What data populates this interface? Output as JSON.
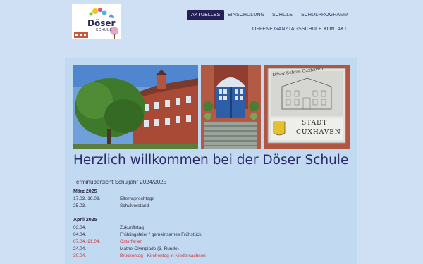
{
  "logo": {
    "title": "Döser",
    "subtitle": "SCHULE"
  },
  "nav": {
    "items": [
      {
        "label": "AKTUELLES",
        "active": true
      },
      {
        "label": "EINSCHULUNG"
      },
      {
        "label": "SCHULE"
      },
      {
        "label": "SCHULPROGRAMM"
      },
      {
        "label": "OFFENE GANZTAGSSCHULE"
      },
      {
        "label": "KONTAKT"
      }
    ]
  },
  "photos": {
    "sign": {
      "line1": "Döser Schule Cuxhaven",
      "line2": "STADT",
      "line3": "CUXHAVEN"
    }
  },
  "main": {
    "title": "Herzlich willkommen bei der Döser Schule",
    "subtitle": "Terminübersicht Schuljahr 2024/2025",
    "months": [
      {
        "name": "März 2025",
        "events": [
          {
            "date": "17.03.-19.03.",
            "event": "Elternsprechtage",
            "highlight": false
          },
          {
            "date": "25.03.",
            "event": "Schulvorstand",
            "highlight": false
          }
        ]
      },
      {
        "name": "April 2025",
        "events": [
          {
            "date": "03.04.",
            "event": "Zukunftstag",
            "highlight": false
          },
          {
            "date": "04.04.",
            "event": "Frühlingsfeier / gemeinsames Frühstück",
            "highlight": false
          },
          {
            "date": "07.04.-21.04.",
            "event": "Osterferien",
            "highlight": true
          },
          {
            "date": "24.04.",
            "event": "Mathe-Olympiade (3. Runde)",
            "highlight": false
          },
          {
            "date": "30.04.",
            "event": "Brückentag - Kirchentag in Niedersachsen",
            "highlight": true
          }
        ]
      }
    ]
  },
  "colors": {
    "page_bg": "#cfe0f4",
    "content_bg": "#c1d9f1",
    "nav_active_bg": "#241f55",
    "title": "#2a2a6a",
    "highlight": "#d6302c"
  }
}
